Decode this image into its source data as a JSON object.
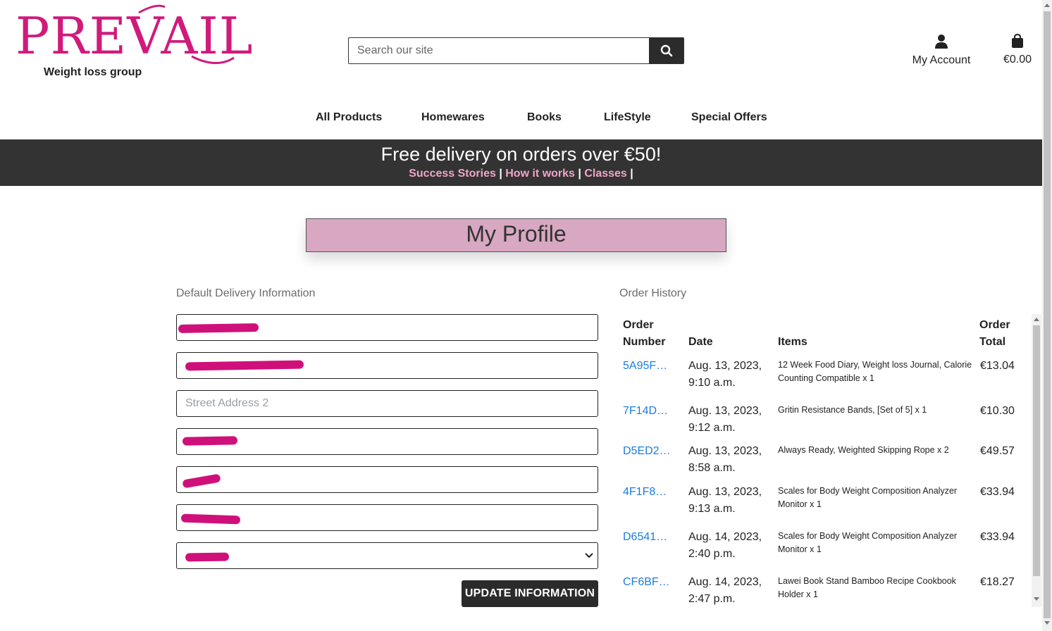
{
  "brand": {
    "name": "PREVAIL",
    "tagline": "Weight loss group",
    "color": "#d01a7c"
  },
  "search": {
    "placeholder": "Search our site",
    "button_icon": "search-icon"
  },
  "account": {
    "label": "My Account",
    "icon": "user-icon"
  },
  "cart": {
    "total": "€0.00",
    "icon": "shopping-bag-icon"
  },
  "nav": {
    "items": [
      "All Products",
      "Homewares",
      "Books",
      "LifeStyle",
      "Special Offers"
    ]
  },
  "banner": {
    "title": "Free delivery on orders over €50!",
    "links": [
      "Success Stories",
      "How it works",
      "Classes"
    ],
    "separator": "|"
  },
  "profile": {
    "title": "My Profile",
    "delivery_label": "Default Delivery Information",
    "street2_placeholder": "Street Address 2",
    "update_button": "UPDATE INFORMATION"
  },
  "orders": {
    "label": "Order History",
    "headers": {
      "number_l1": "Order",
      "number_l2": "Number",
      "date": "Date",
      "items": "Items",
      "total_l1": "Order",
      "total_l2": "Total"
    },
    "rows": [
      {
        "number": "5A95F…",
        "date": "Aug. 13, 2023,",
        "time": "9:10 a.m.",
        "items": "12 Week Food Diary, Weight loss Journal, Calorie Counting Compatible x 1",
        "total": "€13.04"
      },
      {
        "number": "7F14D…",
        "date": "Aug. 13, 2023,",
        "time": "9:12 a.m.",
        "items": "Gritin Resistance Bands, [Set of 5] x 1",
        "total": "€10.30"
      },
      {
        "number": "D5ED2…",
        "date": "Aug. 13, 2023,",
        "time": "8:58 a.m.",
        "items": "Always Ready, Weighted Skipping Rope x 2",
        "total": "€49.57"
      },
      {
        "number": "4F1F8…",
        "date": "Aug. 13, 2023,",
        "time": "9:13 a.m.",
        "items": "Scales for Body Weight Composition Analyzer Monitor x 1",
        "total": "€33.94"
      },
      {
        "number": "D6541…",
        "date": "Aug. 14, 2023,",
        "time": "2:40 p.m.",
        "items": "Scales for Body Weight Composition Analyzer Monitor x 1",
        "total": "€33.94"
      },
      {
        "number": "CF6BF…",
        "date": "Aug. 14, 2023,",
        "time": "2:47 p.m.",
        "items": "Lawei Book Stand Bamboo Recipe Cookbook Holder x 1",
        "total": "€18.27"
      }
    ]
  },
  "colors": {
    "accent": "#d01a7c",
    "banner_bg": "#333333",
    "link": "#1a7de0",
    "profile_bg": "#d8a7c1",
    "banner_link": "#f0a4c8"
  }
}
